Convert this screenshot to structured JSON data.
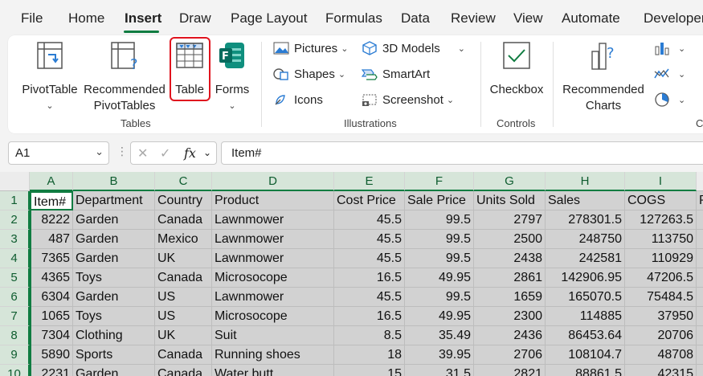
{
  "menu": {
    "tabs": [
      "File",
      "Home",
      "Insert",
      "Draw",
      "Page Layout",
      "Formulas",
      "Data",
      "Review",
      "View",
      "Automate",
      "Developer"
    ],
    "active": "Insert"
  },
  "ribbon": {
    "pivottable": "PivotTable",
    "recommended_pivottables_1": "Recommended",
    "recommended_pivottables_2": "PivotTables",
    "table": "Table",
    "forms": "Forms",
    "tables_group": "Tables",
    "pictures": "Pictures",
    "shapes": "Shapes",
    "icons": "Icons",
    "models3d": "3D Models",
    "smartart": "SmartArt",
    "screenshot": "Screenshot",
    "illustrations_group": "Illustrations",
    "checkbox": "Checkbox",
    "controls_group": "Controls",
    "recommended_charts_1": "Recommended",
    "recommended_charts_2": "Charts",
    "charts_group_partial": "C"
  },
  "formula_bar": {
    "name_box": "A1",
    "fx": "fx",
    "content": "Item#"
  },
  "sheet": {
    "columns": [
      "A",
      "B",
      "C",
      "D",
      "E",
      "F",
      "G",
      "H",
      "I"
    ],
    "rows": [
      "1",
      "2",
      "3",
      "4",
      "5",
      "6",
      "7",
      "8",
      "9",
      "10"
    ],
    "header": [
      "Item#",
      "Department",
      "Country",
      "Product",
      "Cost Price",
      "Sale Price",
      "Units Sold",
      "Sales",
      "COGS",
      "P"
    ],
    "data": [
      [
        "8222",
        "Garden",
        "Canada",
        "Lawnmower",
        "45.5",
        "99.5",
        "2797",
        "278301.5",
        "127263.5"
      ],
      [
        "487",
        "Garden",
        "Mexico",
        "Lawnmower",
        "45.5",
        "99.5",
        "2500",
        "248750",
        "113750"
      ],
      [
        "7365",
        "Garden",
        "UK",
        "Lawnmower",
        "45.5",
        "99.5",
        "2438",
        "242581",
        "110929"
      ],
      [
        "4365",
        "Toys",
        "Canada",
        "Microsocope",
        "16.5",
        "49.95",
        "2861",
        "142906.95",
        "47206.5"
      ],
      [
        "6304",
        "Garden",
        "US",
        "Lawnmower",
        "45.5",
        "99.5",
        "1659",
        "165070.5",
        "75484.5"
      ],
      [
        "1065",
        "Toys",
        "US",
        "Microsocope",
        "16.5",
        "49.95",
        "2300",
        "114885",
        "37950"
      ],
      [
        "7304",
        "Clothing",
        "UK",
        "Suit",
        "8.5",
        "35.49",
        "2436",
        "86453.64",
        "20706"
      ],
      [
        "5890",
        "Sports",
        "Canada",
        "Running shoes",
        "18",
        "39.95",
        "2706",
        "108104.7",
        "48708"
      ],
      [
        "2231",
        "Garden",
        "Canada",
        "Water butt",
        "15",
        "31.5",
        "2821",
        "88861.5",
        "42315"
      ]
    ]
  },
  "colors": {
    "accent": "#107c41",
    "highlight": "#e0141e"
  }
}
